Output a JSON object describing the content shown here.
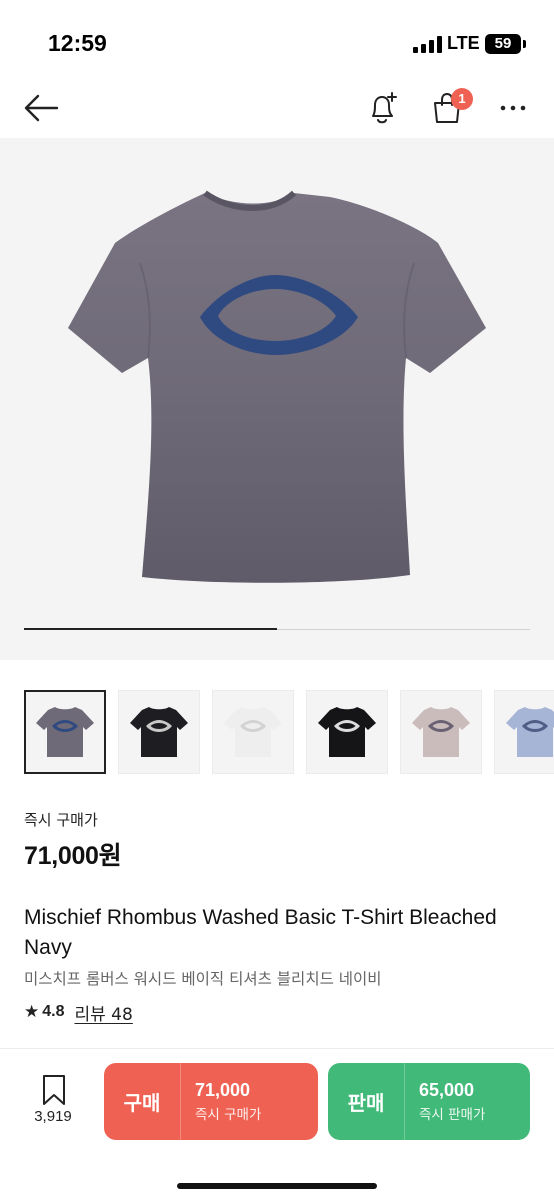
{
  "status_bar": {
    "time": "12:59",
    "network": "LTE",
    "battery": "59"
  },
  "nav": {
    "cart_badge": "1"
  },
  "hero": {
    "image_progress": 0.5
  },
  "thumbnails": [
    {
      "color_name": "bleached-navy",
      "shirt_color": "#6f6a78",
      "logo_color": "#2f4a80",
      "selected": true
    },
    {
      "color_name": "black",
      "shirt_color": "#1e1e22",
      "logo_color": "#c9c9c9",
      "selected": false
    },
    {
      "color_name": "white",
      "shirt_color": "#eeeeee",
      "logo_color": "#d2d2d2",
      "selected": false
    },
    {
      "color_name": "black-alt",
      "shirt_color": "#151518",
      "logo_color": "#dcdcdc",
      "selected": false
    },
    {
      "color_name": "pink-gray",
      "shirt_color": "#cbbcbc",
      "logo_color": "#6a6272",
      "selected": false
    },
    {
      "color_name": "light-blue",
      "shirt_color": "#a6b4d6",
      "logo_color": "#4f5e86",
      "selected": false
    }
  ],
  "price": {
    "label": "즉시 구매가",
    "value": "71,000원"
  },
  "product": {
    "title_en": "Mischief Rhombus Washed Basic T-Shirt Bleached Navy",
    "title_ko": "미스치프 롬버스 워시드 베이직 티셔츠 블리치드 네이비",
    "rating": "4.8",
    "review_link": "리뷰 48"
  },
  "bottom_bar": {
    "wish_count": "3,919",
    "buy": {
      "label": "구매",
      "price": "71,000",
      "sub": "즉시 구매가",
      "color": "#ef6253"
    },
    "sell": {
      "label": "판매",
      "price": "65,000",
      "sub": "즉시 판매가",
      "color": "#41b979"
    }
  },
  "colors": {
    "shirt_main": "#6f6a78",
    "logo_main": "#2f4a80",
    "hero_bg": "#f4f4f4"
  }
}
